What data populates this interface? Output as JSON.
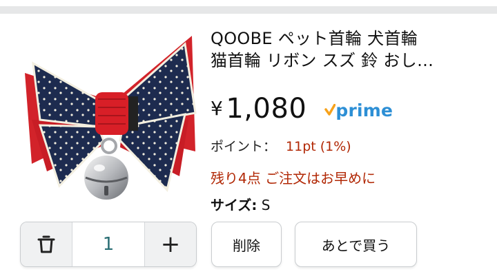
{
  "product": {
    "title_line1": "QOOBE ペット首輪 犬首輪",
    "title_line2": "猫首輪 リボン スズ 鈴 おし…",
    "price_symbol": "¥",
    "price_value": "1,080",
    "prime_label": "prime",
    "points_label": "ポイント：",
    "points_value": "11pt (1%)",
    "stock_text": "残り4点 ご注文はお早めに",
    "size_label": "サイズ:",
    "size_value": "S"
  },
  "cart": {
    "quantity": "1",
    "delete_label": "削除",
    "save_later_label": "あとで買う"
  },
  "colors": {
    "price_red": "#b12704",
    "prime_blue": "#2d8fd5",
    "prime_orange": "#f7a21b",
    "qty_text": "#2a6e74"
  },
  "icons": {
    "delete": "trash-icon",
    "increment": "plus-icon",
    "prime": "prime-check-icon"
  }
}
